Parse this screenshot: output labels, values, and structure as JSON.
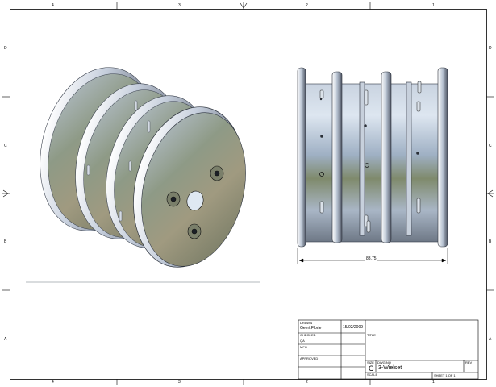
{
  "sheet": {
    "border_zones_top": [
      "4",
      "3",
      "2",
      "1"
    ],
    "border_zones_bottom": [
      "4",
      "3",
      "2",
      "1"
    ],
    "border_zones_left": [
      "D",
      "C",
      "B",
      "A"
    ],
    "border_zones_right": [
      "D",
      "C",
      "B",
      "A"
    ]
  },
  "side_view": {
    "dimension": "83.75"
  },
  "title_block": {
    "drawn_label": "DRAWN",
    "drawn_name": "Geert Florie",
    "drawn_date": "15/02/2009",
    "checked_label": "CHECKED",
    "title_label": "TITLE",
    "qa_label": "QA",
    "mfg_label": "MFG",
    "approved_label": "APPROVED",
    "size_label": "SIZE",
    "size_value": "C",
    "dwg_no_label": "DWG NO",
    "dwg_no_value": "3-Wielset",
    "rev_label": "REV",
    "scale_label": "SCALE",
    "sheet_text": "SHEET 1  OF 1"
  },
  "colors": {
    "line": "#000000",
    "metal_light": "#e8edf5",
    "metal_mid": "#9aa6b8",
    "metal_dark": "#4a5260",
    "sky": "#9fb4cc",
    "ground": "#8b8a6a"
  }
}
